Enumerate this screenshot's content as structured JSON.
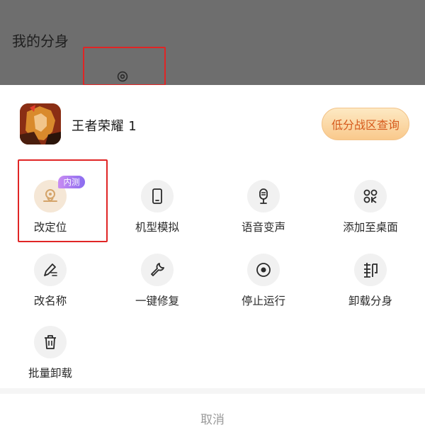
{
  "header": {
    "title": "我的分身",
    "gear_icon": "gear-icon"
  },
  "app": {
    "name": "王者荣耀 1",
    "icon": "game-app-icon",
    "query_button_label": "低分战区查询",
    "query_button_color": "#d65a1c"
  },
  "badge": {
    "label": "内测",
    "color": "#a87af0"
  },
  "actions": [
    {
      "label": "改定位",
      "icon": "location-icon"
    },
    {
      "label": "机型模拟",
      "icon": "phone-icon"
    },
    {
      "label": "语音变声",
      "icon": "microphone-icon"
    },
    {
      "label": "添加至桌面",
      "icon": "add-to-desktop-icon"
    },
    {
      "label": "改名称",
      "icon": "rename-pen-icon"
    },
    {
      "label": "一键修复",
      "icon": "wrench-icon"
    },
    {
      "label": "停止运行",
      "icon": "stop-icon"
    },
    {
      "label": "卸载分身",
      "icon": "uninstall-icon"
    },
    {
      "label": "批量卸载",
      "icon": "trash-icon"
    }
  ],
  "cancel_label": "取消",
  "highlight_color": "#e02525"
}
